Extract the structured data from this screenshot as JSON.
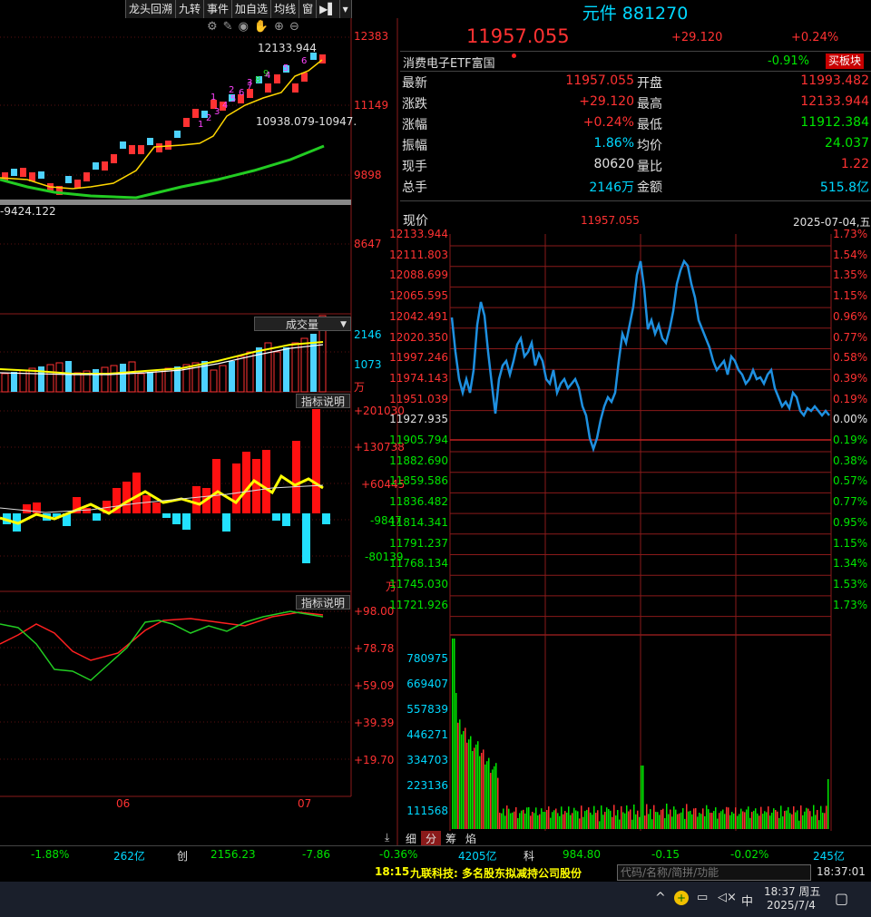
{
  "toolbar": {
    "items": [
      "龙头回溯",
      "九转",
      "事件",
      "加自选",
      "均线",
      "窗"
    ],
    "more": "▶▌"
  },
  "kline": {
    "price_axis": [
      "12383",
      "11149",
      "9898",
      "8647"
    ],
    "high_label": "12133.944",
    "range_label": "10938.079-10947.",
    "low_label": "-9424.122",
    "td_nums": [
      "1",
      "2",
      "3",
      "4",
      "5",
      "6",
      "7",
      "8",
      "9",
      "1",
      "2",
      "3",
      "4",
      "5",
      "6"
    ]
  },
  "volume": {
    "selector": "成交量",
    "axis": [
      "2146",
      "1073"
    ],
    "unit": "万"
  },
  "macd": {
    "button": "指标说明",
    "axis": [
      "+201030",
      "+130738",
      "+60445",
      "-9847",
      "-80139"
    ],
    "unit": "万"
  },
  "kdj": {
    "button": "指标说明",
    "axis": [
      "+98.00",
      "+78.78",
      "+59.09",
      "+39.39",
      "+19.70"
    ]
  },
  "date_axis": [
    "06",
    "07"
  ],
  "stock": {
    "name": "元件",
    "code": "881270",
    "price": "11957.055",
    "change": "+29.120",
    "pct": "+0.24%"
  },
  "etf": {
    "name": "消费电子ETF富国",
    "pct": "-0.91%",
    "button": "买板块"
  },
  "quote_rows": [
    {
      "l": "最新",
      "lv": "11957.055",
      "r": "开盘",
      "rv": "11993.482",
      "lc": "#ff3232",
      "rc": "#ff3232"
    },
    {
      "l": "涨跌",
      "lv": "+29.120",
      "r": "最高",
      "rv": "12133.944",
      "lc": "#ff3232",
      "rc": "#ff3232"
    },
    {
      "l": "涨幅",
      "lv": "+0.24%",
      "r": "最低",
      "rv": "11912.384",
      "lc": "#ff3232",
      "rc": "#00e600"
    },
    {
      "l": "振幅",
      "lv": "1.86%",
      "r": "均价",
      "rv": "24.037",
      "lc": "#00d8ff",
      "rc": "#00e600"
    },
    {
      "l": "现手",
      "lv": "80620",
      "r": "量比",
      "rv": "1.22",
      "lc": "#e0e0e0",
      "rc": "#ff3232"
    },
    {
      "l": "总手",
      "lv": "2146万",
      "r": "金额",
      "rv": "515.8亿",
      "lc": "#00d8ff",
      "rc": "#00d8ff"
    }
  ],
  "intraday": {
    "label": "现价",
    "price": "11957.055",
    "date": "2025-07-04,五",
    "price_axis": [
      "12133.944",
      "12111.803",
      "12088.699",
      "12065.595",
      "12042.491",
      "12020.350",
      "11997.246",
      "11974.143",
      "11951.039",
      "11927.935",
      "11905.794",
      "11882.690",
      "11859.586",
      "11836.482",
      "11814.341",
      "11791.237",
      "11768.134",
      "11745.030",
      "11721.926"
    ],
    "pct_axis": [
      "1.73%",
      "1.54%",
      "1.35%",
      "1.15%",
      "0.96%",
      "0.77%",
      "0.58%",
      "0.39%",
      "0.19%",
      "0.00%",
      "0.19%",
      "0.38%",
      "0.57%",
      "0.77%",
      "0.95%",
      "1.15%",
      "1.34%",
      "1.53%",
      "1.73%"
    ],
    "vol_axis": [
      "780975",
      "669407",
      "557839",
      "446271",
      "334703",
      "223136",
      "111568"
    ]
  },
  "tabs": [
    "细",
    "分",
    "筹",
    "焰"
  ],
  "bottom": {
    "a": "-1.88%",
    "b": "262亿",
    "c": "创",
    "d": "2156.23",
    "e": "-7.86",
    "f": "-0.36%",
    "g": "4205亿",
    "h": "科",
    "i": "984.80",
    "j": "-0.15",
    "k": "-0.02%",
    "l": "245亿"
  },
  "news": {
    "time": "18:15",
    "text": "九联科技: 多名股东拟减持公司股份",
    "search_placeholder": "代码/名称/简拼/功能",
    "clock": "18:37:01"
  },
  "taskbar": {
    "ime": "中",
    "time": "18:37 周五",
    "date": "2025/7/4"
  }
}
